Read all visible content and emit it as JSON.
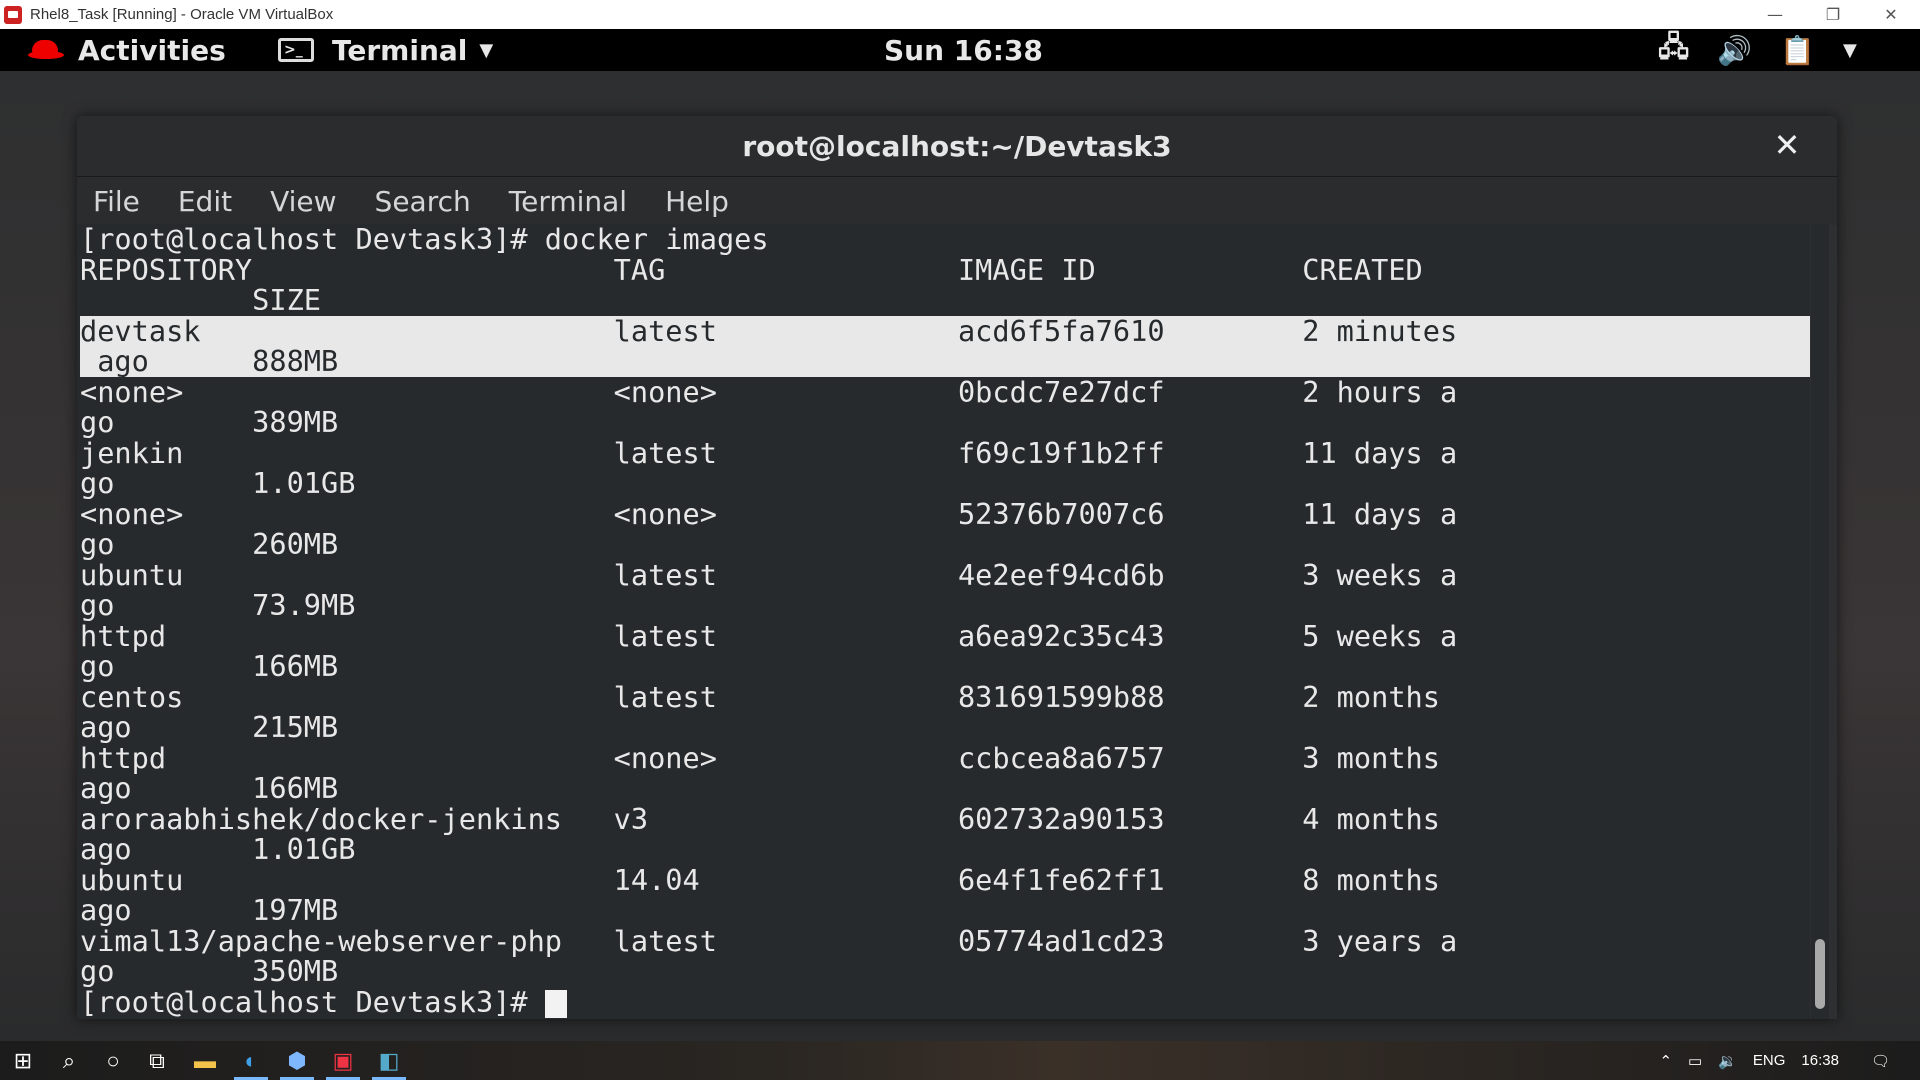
{
  "vbox": {
    "title": "Rhel8_Task [Running] - Oracle VM VirtualBox",
    "minimize": "—",
    "restore": "❐",
    "close": "✕"
  },
  "gnome": {
    "activities": "Activities",
    "app_menu": "Terminal",
    "clock": "Sun 16:38"
  },
  "terminal": {
    "title": "root@localhost:~/Devtask3",
    "menu": [
      "File",
      "Edit",
      "View",
      "Search",
      "Terminal",
      "Help"
    ],
    "lines": [
      "[root@localhost Devtask3]# docker images",
      "REPOSITORY                     TAG                 IMAGE ID            CREATED",
      "          SIZE",
      "devtask                        latest              acd6f5fa7610        2 minutes",
      " ago      888MB",
      "<none>                         <none>              0bcdc7e27dcf        2 hours a",
      "go        389MB",
      "jenkin                         latest              f69c19f1b2ff        11 days a",
      "go        1.01GB",
      "<none>                         <none>              52376b7007c6        11 days a",
      "go        260MB",
      "ubuntu                         latest              4e2eef94cd6b        3 weeks a",
      "go        73.9MB",
      "httpd                          latest              a6ea92c35c43        5 weeks a",
      "go        166MB",
      "centos                         latest              831691599b88        2 months",
      "ago       215MB",
      "httpd                          <none>              ccbcea8a6757        3 months",
      "ago       166MB",
      "aroraabhishek/docker-jenkins   v3                  602732a90153        4 months",
      "ago       1.01GB",
      "ubuntu                         14.04               6e4f1fe62ff1        8 months",
      "ago       197MB",
      "vimal13/apache-webserver-php   latest              05774ad1cd23        3 years a",
      "go        350MB",
      "[root@localhost Devtask3]# "
    ]
  },
  "taskbar": {
    "lang": "ENG",
    "time": "16:38"
  }
}
